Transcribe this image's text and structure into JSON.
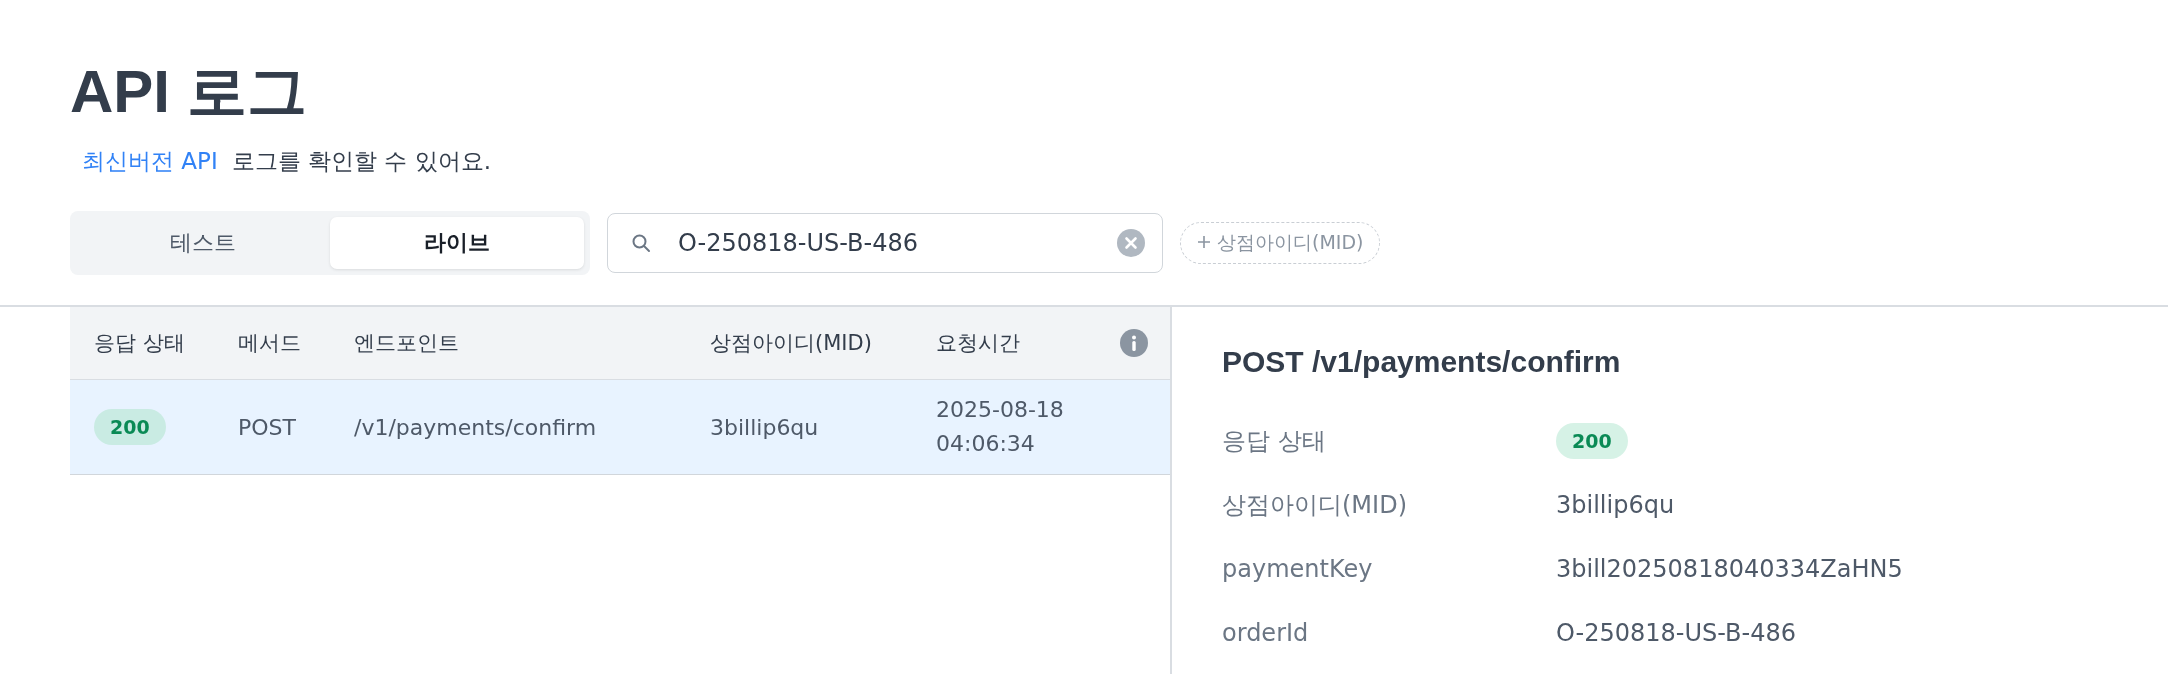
{
  "page": {
    "title": "API 로그",
    "subtitle_link": "최신버전 API",
    "subtitle": "로그를 확인할 수 있어요."
  },
  "env_tabs": [
    {
      "label": "테스트",
      "selected": false
    },
    {
      "label": "라이브",
      "selected": true
    }
  ],
  "search": {
    "value": "O-250818-US-B-486"
  },
  "filter_chip": {
    "label": "상점아이디(MID)"
  },
  "table": {
    "columns": [
      "응답 상태",
      "메서드",
      "엔드포인트",
      "상점아이디(MID)",
      "요청시간"
    ],
    "rows": [
      {
        "status": "200",
        "method": "POST",
        "endpoint": "/v1/payments/confirm",
        "mid": "3billip6qu",
        "time": "2025-08-18\n04:06:34",
        "selected": true
      }
    ]
  },
  "detail": {
    "title": "POST /v1/payments/confirm",
    "fields": [
      {
        "kind": "badge",
        "label": "응답 상태",
        "value": "200"
      },
      {
        "kind": "text",
        "label": "상점아이디(MID)",
        "value": "3billip6qu"
      },
      {
        "kind": "text",
        "label": "paymentKey",
        "value": "3bill20250818040334ZaHN5"
      },
      {
        "kind": "text",
        "label": "orderId",
        "value": "O-250818-US-B-486"
      }
    ]
  }
}
